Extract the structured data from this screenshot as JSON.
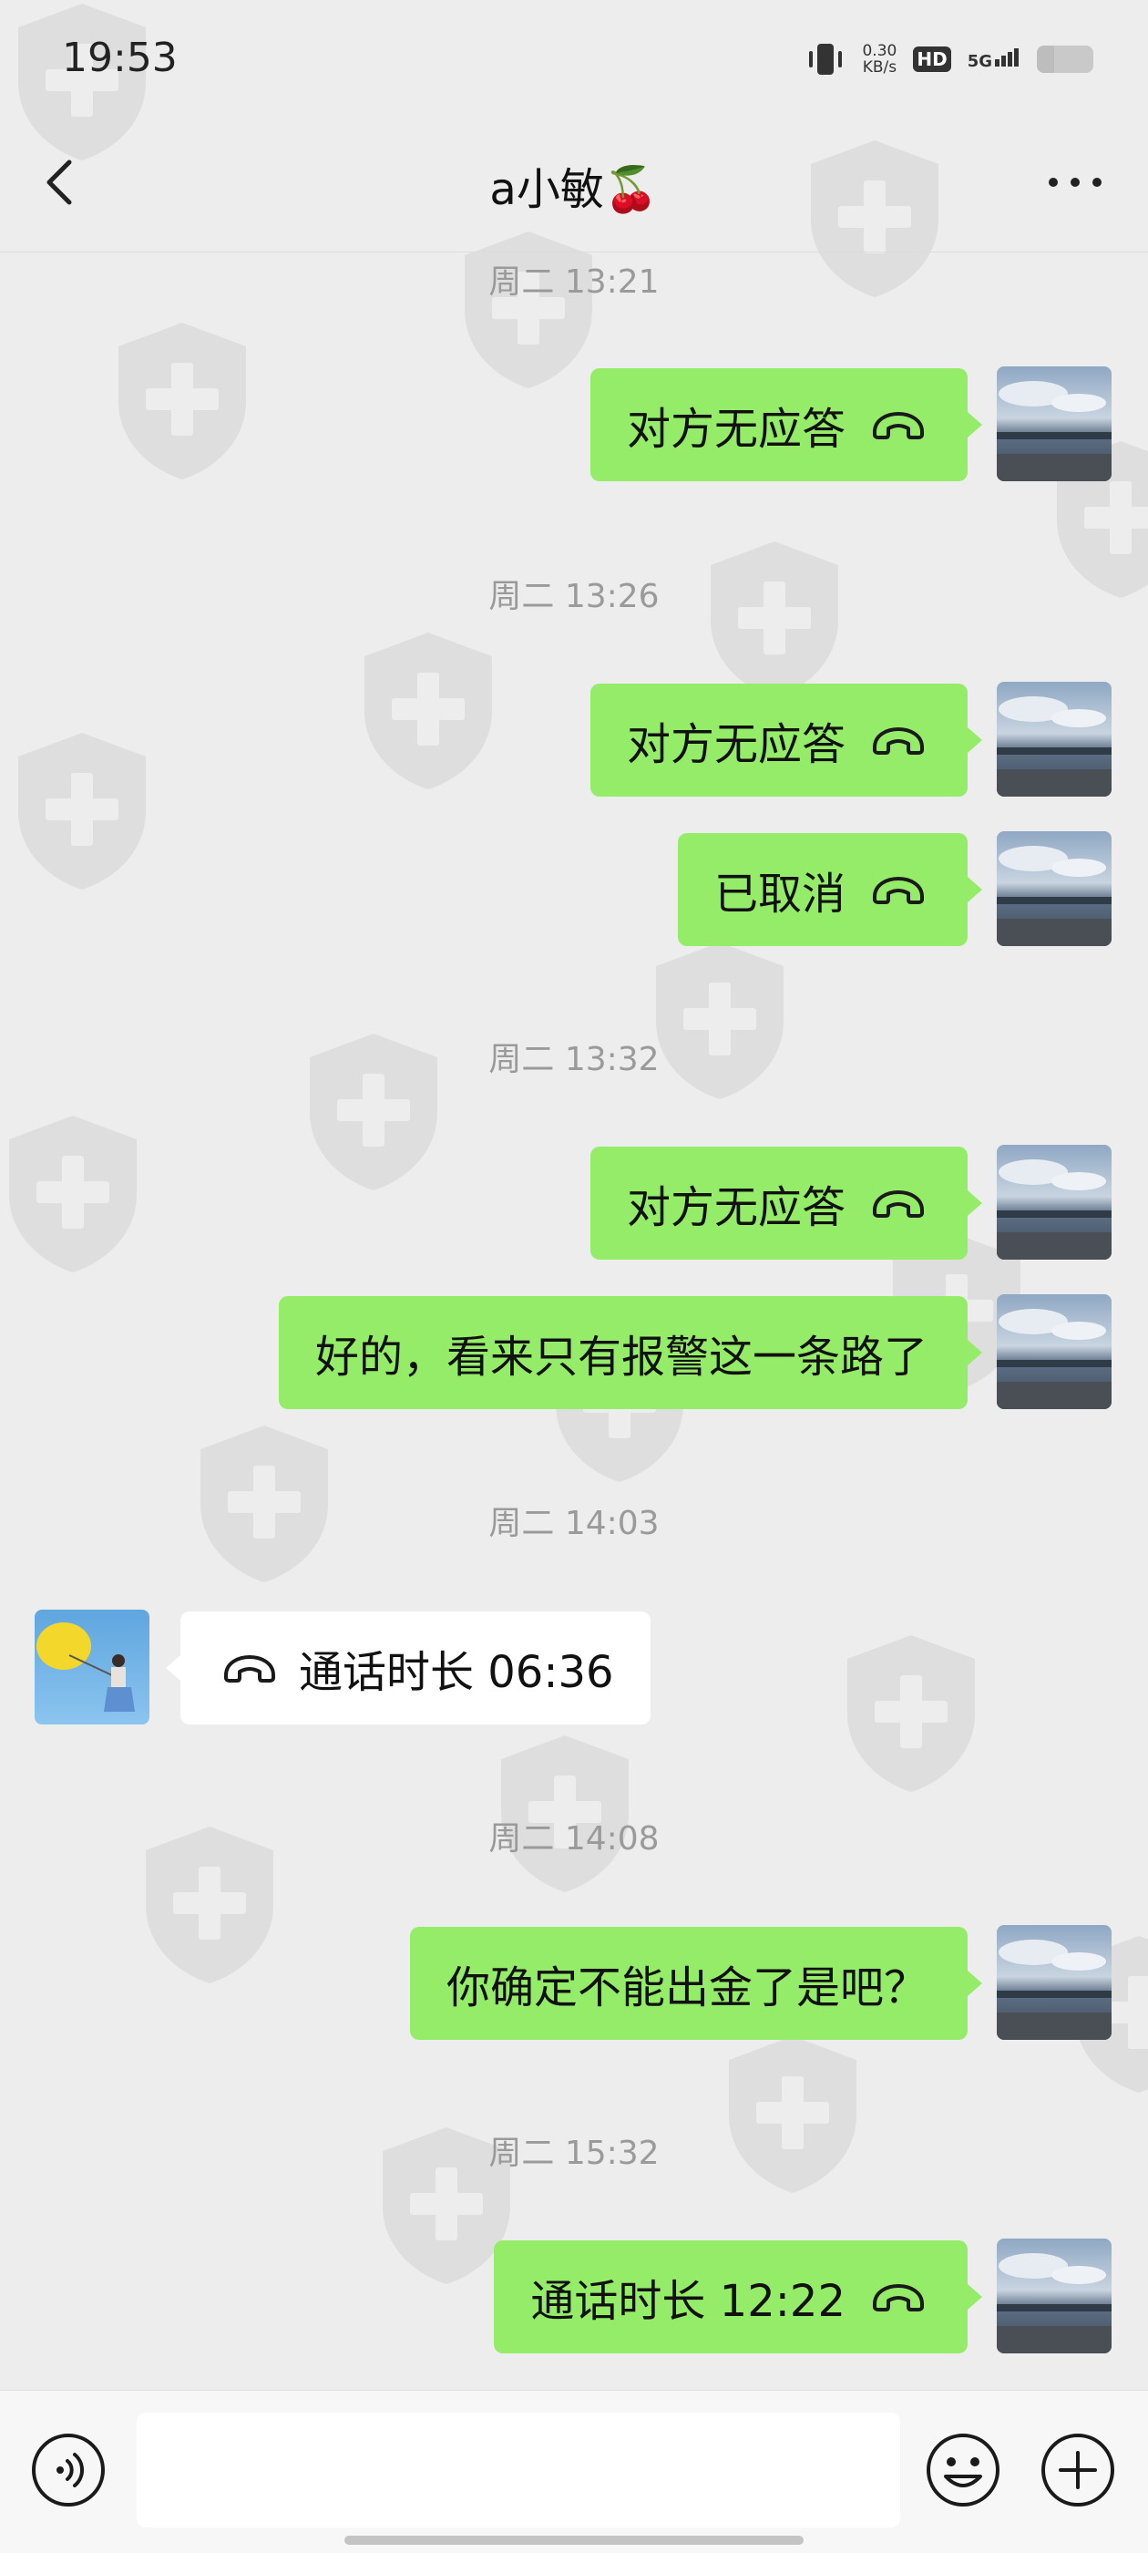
{
  "status_bar": {
    "time": "19:53",
    "net_speed_value": "0.30",
    "net_speed_unit": "KB/s",
    "hd_badge": "HD",
    "network_type": "5G",
    "battery_level": 0.3,
    "icons": [
      "vibrate-icon",
      "signal-icon",
      "battery-icon"
    ]
  },
  "header": {
    "title": "a小敏🍒",
    "back_icon": "chevron-left-icon",
    "more_icon": "more-dots-icon"
  },
  "colors": {
    "background": "#ededed",
    "outgoing_bubble": "#95ec69",
    "incoming_bubble": "#ffffff",
    "timestamp": "#9a9a9a"
  },
  "messages": {
    "ts1": "周二 13:21",
    "m1": "对方无应答",
    "ts2": "周二 13:26",
    "m2": "对方无应答",
    "m3": "已取消",
    "ts3": "周二 13:32",
    "m4": "对方无应答",
    "m5": "好的，看来只有报警这一条路了",
    "ts4": "周二 14:03",
    "m6": "通话时长 06:36",
    "ts5": "周二 14:08",
    "m7": "你确定不能出金了是吧？",
    "ts6": "周二 15:32",
    "m8": "通话时长 12:22"
  },
  "input_bar": {
    "value": "",
    "icons": [
      "voice-icon",
      "emoji-icon",
      "plus-icon"
    ]
  }
}
